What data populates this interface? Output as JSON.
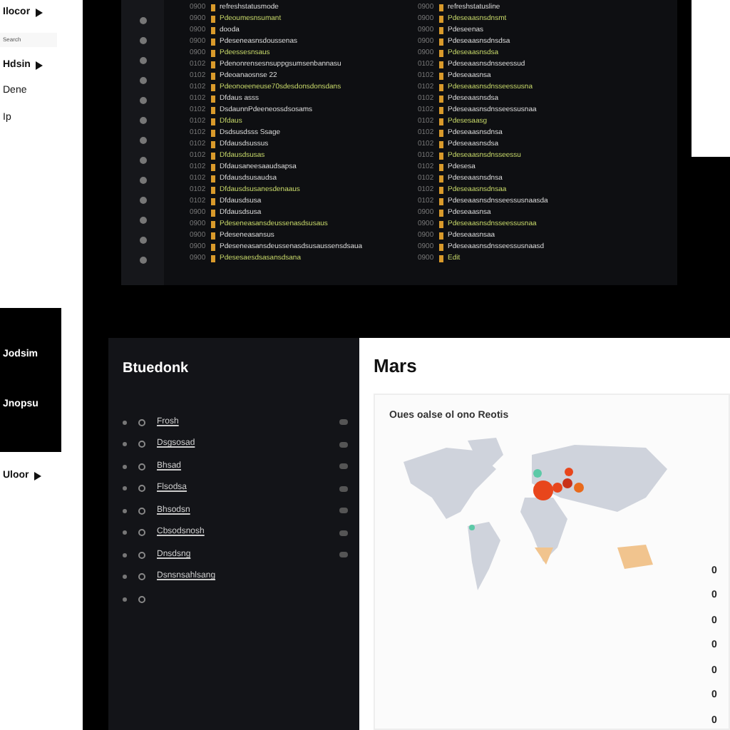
{
  "sidebar": {
    "items": [
      {
        "kind": "menu",
        "label": "Ilocor"
      },
      {
        "kind": "field",
        "placeholder": "Search"
      },
      {
        "kind": "menu",
        "label": "Hdsin"
      },
      {
        "kind": "link",
        "label": "Dene"
      },
      {
        "kind": "link",
        "label": "Ip"
      }
    ],
    "dark_block": {
      "items": [
        "Jodsim",
        "Jnopsu"
      ]
    },
    "footer_item": {
      "label": "Uloor"
    }
  },
  "log": {
    "columns": [
      {
        "lines": [
          {
            "time": "0900",
            "text": "refreshstatusmode"
          },
          {
            "time": "0900",
            "text": "Pdeoumesnsumant"
          },
          {
            "time": "0900",
            "text": "dooda"
          },
          {
            "time": "0900",
            "text": "Pdeseneasnsdoussenas"
          },
          {
            "time": "0900",
            "text": "Pdeessesnsaus"
          },
          {
            "time": "0102",
            "text": "Pdenonrensesnsuppgsumsenbannasu"
          },
          {
            "time": "0102",
            "text": "Pdeoanaosnse 22"
          },
          {
            "time": "0102",
            "text": "Pdeonoeeneuse70sdesdonsdonsdans"
          },
          {
            "time": "0102",
            "text": "Dfdaus asss"
          },
          {
            "time": "0102",
            "text": "DsdaunnPdeeneossdsosams"
          },
          {
            "time": "0102",
            "text": "Dfdaus"
          },
          {
            "time": "0102",
            "text": "Dsdsusdsss Ssage"
          },
          {
            "time": "0102",
            "text": "Dfdausdsussus"
          },
          {
            "time": "0102",
            "text": "Dfdausdsusas"
          },
          {
            "time": "0102",
            "text": "Dfdausaneesaaudsapsa"
          },
          {
            "time": "0102",
            "text": "Dfdausdsusaudsa"
          },
          {
            "time": "0102",
            "text": "Dfdausdsusanesdenaaus"
          },
          {
            "time": "0102",
            "text": "Dfdausdsusa"
          },
          {
            "time": "0900",
            "text": "Dfdausdsusa"
          },
          {
            "time": "0900",
            "text": "Pdeseneasansdeussenasdsusaus"
          },
          {
            "time": "0900",
            "text": "Pdeseneasansus"
          },
          {
            "time": "0900",
            "text": "Pdeseneasansdeussenasdsusaussensdsaua"
          },
          {
            "time": "0900",
            "text": "Pdesesaesdsasansdsana"
          }
        ]
      },
      {
        "lines": [
          {
            "time": "0900",
            "text": "refreshstatusline"
          },
          {
            "time": "0900",
            "text": "Pdeseaasnsdnsmt"
          },
          {
            "time": "0900",
            "text": "Pdeseenas"
          },
          {
            "time": "0900",
            "text": "Pdeseaasnsdnsdsa"
          },
          {
            "time": "0900",
            "text": "Pdeseaasnsdsa"
          },
          {
            "time": "0102",
            "text": "Pdeseaasnsdnsseessud"
          },
          {
            "time": "0102",
            "text": "Pdeseaasnsa"
          },
          {
            "time": "0102",
            "text": "Pdeseaasnsdnsseessusna"
          },
          {
            "time": "0102",
            "text": "Pdeseaasnsdsa"
          },
          {
            "time": "0102",
            "text": "Pdeseaasnsdnsseessusnaa"
          },
          {
            "time": "0102",
            "text": "Pdesesaasg"
          },
          {
            "time": "0102",
            "text": "Pdeseaasnsdnsa"
          },
          {
            "time": "0102",
            "text": "Pdeseaasnsdsa"
          },
          {
            "time": "0102",
            "text": "Pdeseaasnsdnsseessu"
          },
          {
            "time": "0102",
            "text": "Pdesesa"
          },
          {
            "time": "0102",
            "text": "Pdeseaasnsdnsa"
          },
          {
            "time": "0102",
            "text": "Pdeseaasnsdnsaa"
          },
          {
            "time": "0102",
            "text": "Pdeseaasnsdnsseessusnaasda"
          },
          {
            "time": "0900",
            "text": "Pdeseaasnsa"
          },
          {
            "time": "0900",
            "text": "Pdeseaasnsdnsseessusnaa"
          },
          {
            "time": "0900",
            "text": "Pdeseaasnsaa"
          },
          {
            "time": "0900",
            "text": "Pdeseaasnsdnsseessusnaasd"
          },
          {
            "time": "0900",
            "text": "Edit"
          }
        ]
      }
    ]
  },
  "dashboard": {
    "title": "Btuedonk",
    "items": [
      {
        "label": "Frosh",
        "visible": true
      },
      {
        "label": "Dsgsosad",
        "visible": true
      },
      {
        "label": "Bhsad",
        "visible": true
      },
      {
        "label": "Flsodsa",
        "visible": true
      },
      {
        "label": "Bhsodsn",
        "visible": true
      },
      {
        "label": "Cbsodsnosh",
        "visible": true
      },
      {
        "label": "Dnsdsng",
        "visible": true
      },
      {
        "label": "Dsnsnsahlsang",
        "visible": false
      }
    ]
  },
  "maps": {
    "title": "Mars",
    "card_title": "Oues oalse ol ono Reotis",
    "values": [
      "0",
      "0",
      "0",
      "0",
      "0",
      "0",
      "0"
    ]
  }
}
